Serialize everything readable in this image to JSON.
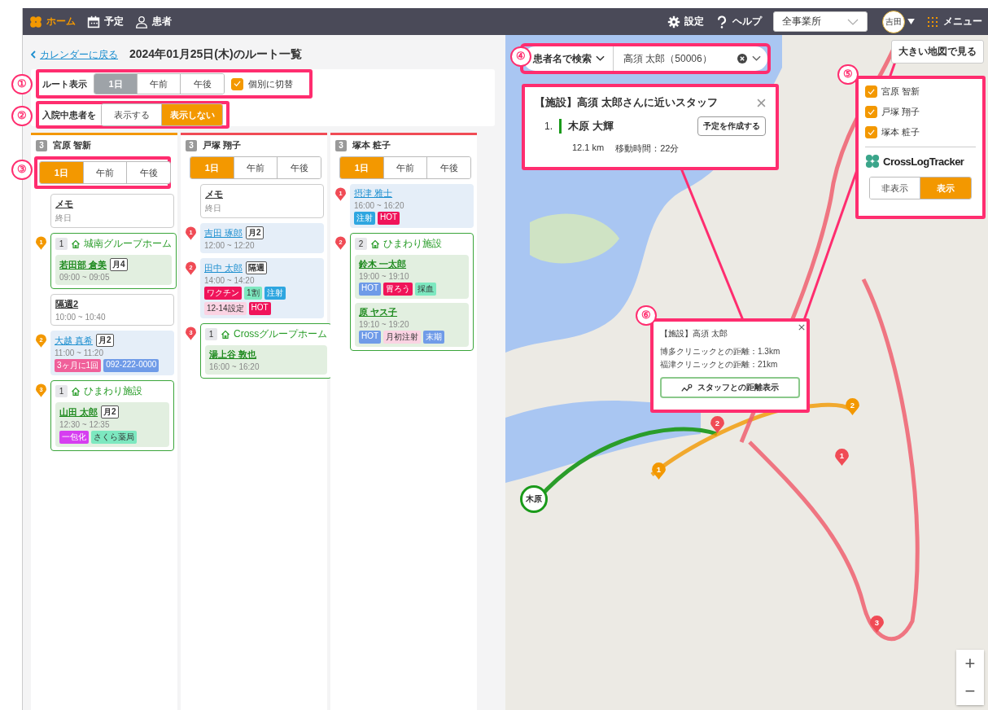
{
  "nav": {
    "items": [
      {
        "label": "ホーム",
        "selected": true
      },
      {
        "label": "予定",
        "selected": false
      },
      {
        "label": "患者",
        "selected": false
      }
    ],
    "settings": "設定",
    "help": "ヘルプ",
    "office_select": "全事業所",
    "user": "吉田",
    "menu": "メニュー"
  },
  "header": {
    "back_link": "カレンダーに戻る",
    "title": "2024年01月25日(木)のルート一覧"
  },
  "route_display": {
    "label": "ルート表示",
    "annotation": "①",
    "disabled": true,
    "options": [
      {
        "label": "1日",
        "selected": true
      },
      {
        "label": "午前",
        "selected": false
      },
      {
        "label": "午後",
        "selected": false
      }
    ],
    "individual_toggle": {
      "label": "個別に切替",
      "checked": true
    }
  },
  "inpatient": {
    "label": "入院中患者を",
    "annotation": "②",
    "options": [
      {
        "label": "表示する",
        "selected": false
      },
      {
        "label": "表示しない",
        "selected": true
      }
    ]
  },
  "staff_columns": [
    {
      "count": "3",
      "name": "宮原 智新",
      "color": "#f39800",
      "annotation": "③",
      "periods": [
        {
          "label": "1日",
          "selected": true
        },
        {
          "label": "午前",
          "selected": false
        },
        {
          "label": "午後",
          "selected": false
        }
      ],
      "items": [
        {
          "kind": "memo",
          "title": "メモ",
          "time": "終日"
        },
        {
          "kind": "facility",
          "pin": "1",
          "count": "1",
          "facility": "城南グループホーム",
          "patients": [
            {
              "name": "若田部 倉美",
              "freq": "月4",
              "time": "09:00 ~ 09:05"
            }
          ]
        },
        {
          "kind": "memo",
          "title": "隔週2",
          "time": "10:00 ~ 10:40"
        },
        {
          "kind": "visit",
          "pin": "2",
          "patients": [
            {
              "name": "大越 真希",
              "freq": "月2",
              "time": "11:00 ~ 11:20",
              "tags": [
                {
                  "label": "3ヶ月に1回",
                  "color": "#f0609a"
                },
                {
                  "label": "092-222-0000",
                  "color": "#6f9be8"
                }
              ]
            }
          ]
        },
        {
          "kind": "facility",
          "pin": "3",
          "count": "1",
          "facility": "ひまわり施設",
          "patients": [
            {
              "name": "山田 太郎",
              "freq": "月2",
              "time": "12:30 ~ 12:35",
              "tags": [
                {
                  "label": "一包化",
                  "color": "#d63ef0"
                },
                {
                  "label": "さくら薬局",
                  "color": "#7de8c0"
                }
              ]
            }
          ]
        }
      ]
    },
    {
      "count": "3",
      "name": "戸塚 翔子",
      "color": "#f04b55",
      "periods": [
        {
          "label": "1日",
          "selected": true
        },
        {
          "label": "午前",
          "selected": false
        },
        {
          "label": "午後",
          "selected": false
        }
      ],
      "items": [
        {
          "kind": "memo",
          "title": "メモ",
          "time": "終日"
        },
        {
          "kind": "visit",
          "pin": "1",
          "patients": [
            {
              "name": "吉田 琢郎",
              "freq": "月2",
              "time": "12:00 ~ 12:20"
            }
          ]
        },
        {
          "kind": "visit",
          "pin": "2",
          "patients": [
            {
              "name": "田中 太郎",
              "freq": "隔週",
              "time": "14:00 ~ 14:20",
              "tags": [
                {
                  "label": "ワクチン",
                  "color": "#f0145a"
                },
                {
                  "label": "1割",
                  "color": "#7de8c0"
                },
                {
                  "label": "注射",
                  "color": "#2ea6e0"
                },
                {
                  "label": "12-14設定",
                  "color": "#fbd3e3"
                },
                {
                  "label": "HOT",
                  "color": "#f0145a"
                }
              ]
            }
          ]
        },
        {
          "kind": "facility",
          "pin": "3",
          "count": "1",
          "facility": "Crossグループホーム",
          "patients": [
            {
              "name": "湯上谷 敦也",
              "time": "16:00 ~ 16:20"
            }
          ]
        }
      ]
    },
    {
      "count": "3",
      "name": "塚本 粧子",
      "color": "#f04b55",
      "periods": [
        {
          "label": "1日",
          "selected": true
        },
        {
          "label": "午前",
          "selected": false
        },
        {
          "label": "午後",
          "selected": false
        }
      ],
      "items": [
        {
          "kind": "visit",
          "pin": "1",
          "patients": [
            {
              "name": "摂津 雅士",
              "time": "16:00 ~ 16:20",
              "tags": [
                {
                  "label": "注射",
                  "color": "#2ea6e0"
                },
                {
                  "label": "HOT",
                  "color": "#f0145a"
                }
              ]
            }
          ]
        },
        {
          "kind": "facility",
          "pin": "2",
          "count": "2",
          "facility": "ひまわり施設",
          "patients": [
            {
              "name": "鈴木 一太郎",
              "time": "19:00 ~ 19:10",
              "tags": [
                {
                  "label": "HOT",
                  "color": "#6f9be8"
                },
                {
                  "label": "胃ろう",
                  "color": "#f0145a"
                },
                {
                  "label": "採血",
                  "color": "#7de8c0"
                }
              ]
            },
            {
              "name": "原 ヤス子",
              "time": "19:10 ~ 19:20",
              "tags": [
                {
                  "label": "HOT",
                  "color": "#6f9be8"
                },
                {
                  "label": "月初注射",
                  "color": "#fbd3e3"
                },
                {
                  "label": "末期",
                  "color": "#6f9be8"
                }
              ]
            }
          ]
        }
      ]
    }
  ],
  "map": {
    "big_map_button": "大きい地図で見る",
    "search": {
      "annotation": "④",
      "mode": "患者名で検索",
      "value": "高須 太郎（50006）"
    },
    "nearby_staff": {
      "title": "【施設】高須 太郎さんに近いスタッフ",
      "staff": [
        {
          "rank": "1.",
          "name": "木原 大輝",
          "color": "#1a9a1a",
          "button": "予定を作成する",
          "distance": "12.1 km",
          "travel": "移動時間：22分"
        }
      ]
    },
    "staff_filter": {
      "annotation": "⑤",
      "staff": [
        {
          "name": "宮原 智新",
          "checked": true
        },
        {
          "name": "戸塚 翔子",
          "checked": true
        },
        {
          "name": "塚本 粧子",
          "checked": true
        }
      ],
      "tracker": {
        "brand": "CrossLogTracker",
        "options": [
          {
            "label": "非表示",
            "selected": false
          },
          {
            "label": "表示",
            "selected": true
          }
        ]
      }
    },
    "info_popup": {
      "annotation": "⑥",
      "title": "【施設】高須 太郎",
      "lines": [
        "博多クリニックとの距離：1.3km",
        "福津クリニックとの距離：21km"
      ],
      "button": "スタッフとの距離表示"
    },
    "pins": [
      {
        "label": "1",
        "color": "#f39800"
      },
      {
        "label": "2",
        "color": "#f39800"
      },
      {
        "label": "1",
        "color": "#f04b55"
      },
      {
        "label": "2",
        "color": "#f04b55"
      },
      {
        "label": "3",
        "color": "#f04b55"
      }
    ],
    "staff_marker": {
      "label": "木原",
      "color": "#1a9a1a"
    },
    "zoom": {
      "in": "+",
      "out": "−"
    }
  }
}
